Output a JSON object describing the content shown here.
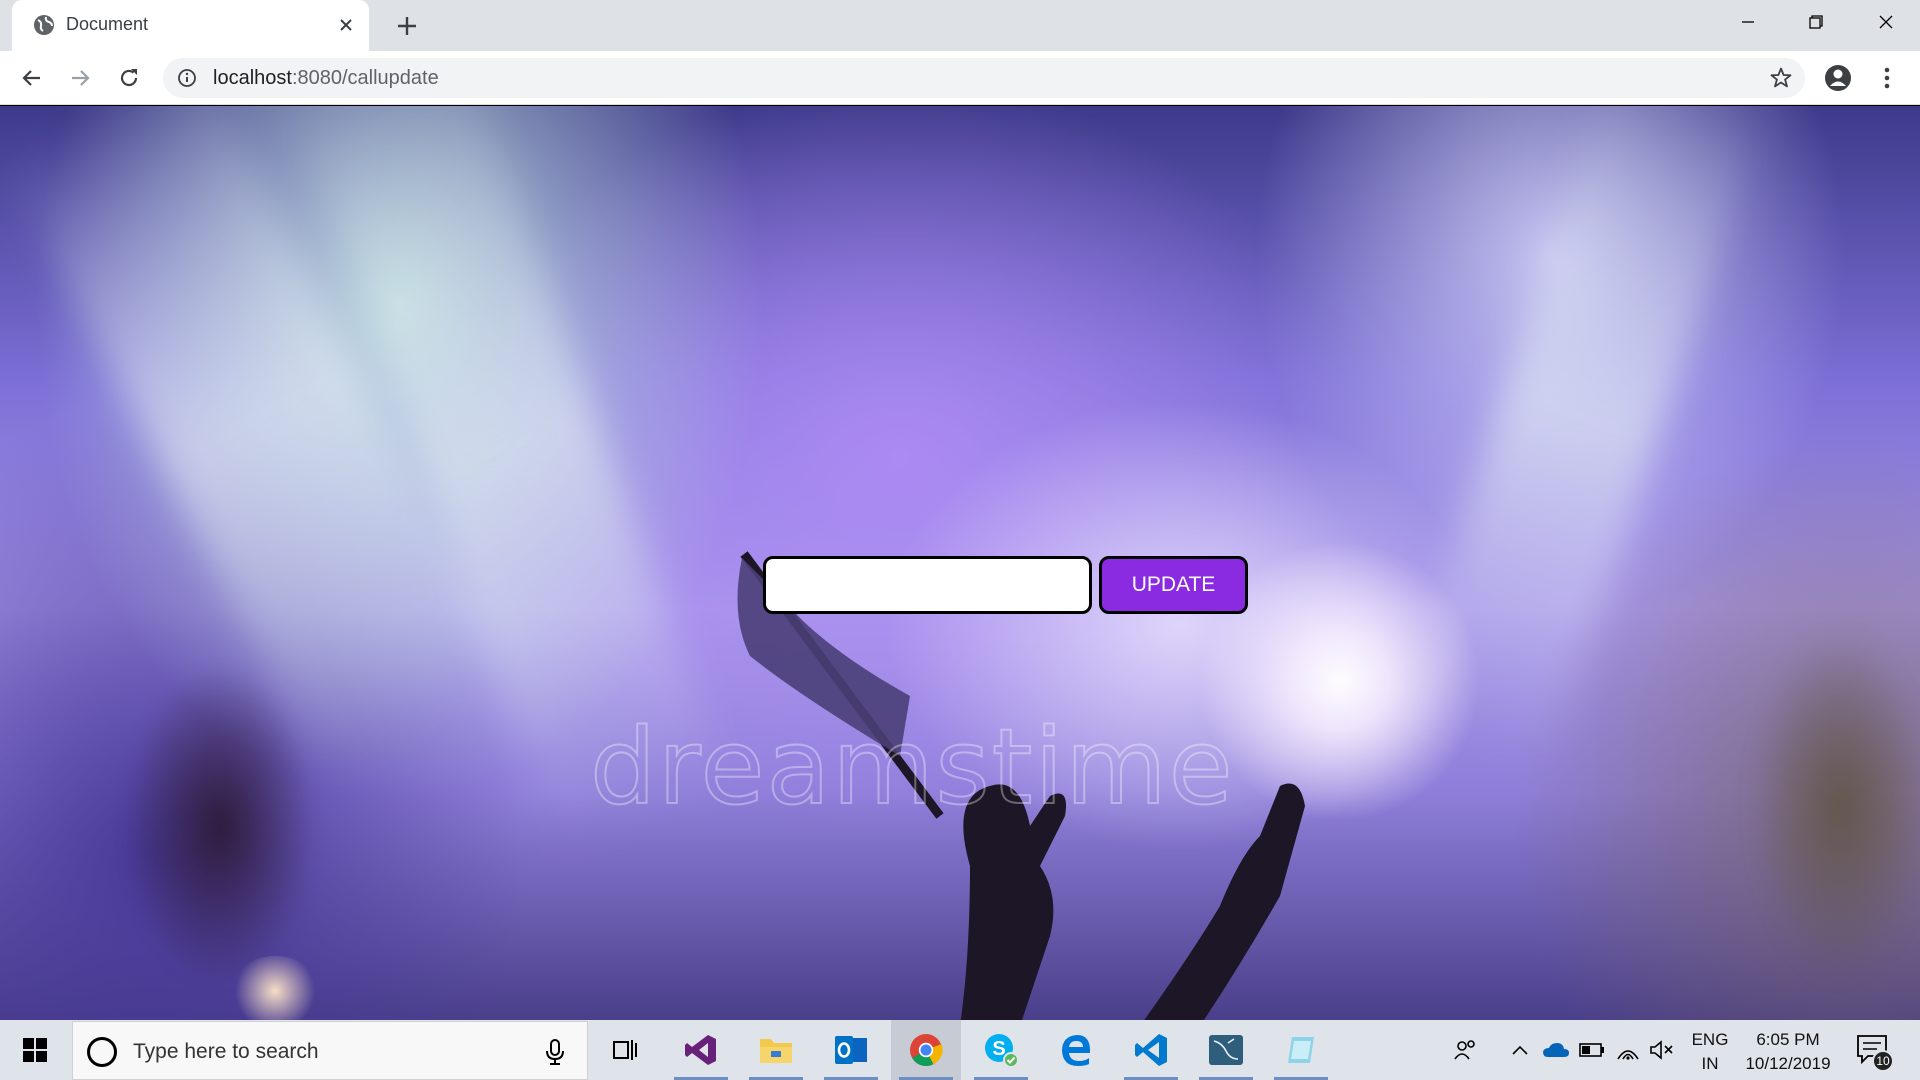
{
  "browser": {
    "tab": {
      "title": "Document",
      "favicon": "globe-icon"
    },
    "omnibox": {
      "host": "localhost",
      "path": ":8080/callupdate"
    },
    "window_controls": [
      "minimize-icon",
      "restore-icon",
      "close-icon"
    ]
  },
  "page": {
    "input": {
      "value": "",
      "placeholder": ""
    },
    "update_label": "UPDATE",
    "watermark": "dreamstime",
    "colors": {
      "button": "#8a2be2"
    }
  },
  "taskbar": {
    "search_placeholder": "Type here to search",
    "apps": [
      "visual-studio-icon",
      "file-explorer-icon",
      "outlook-icon",
      "chrome-icon",
      "skype-icon",
      "edge-icon",
      "vscode-icon",
      "sql-workbench-icon",
      "notepad-icon"
    ],
    "language": {
      "line1": "ENG",
      "line2": "IN"
    },
    "clock": {
      "time": "6:05 PM",
      "date": "10/12/2019"
    },
    "notification_count": "10"
  }
}
